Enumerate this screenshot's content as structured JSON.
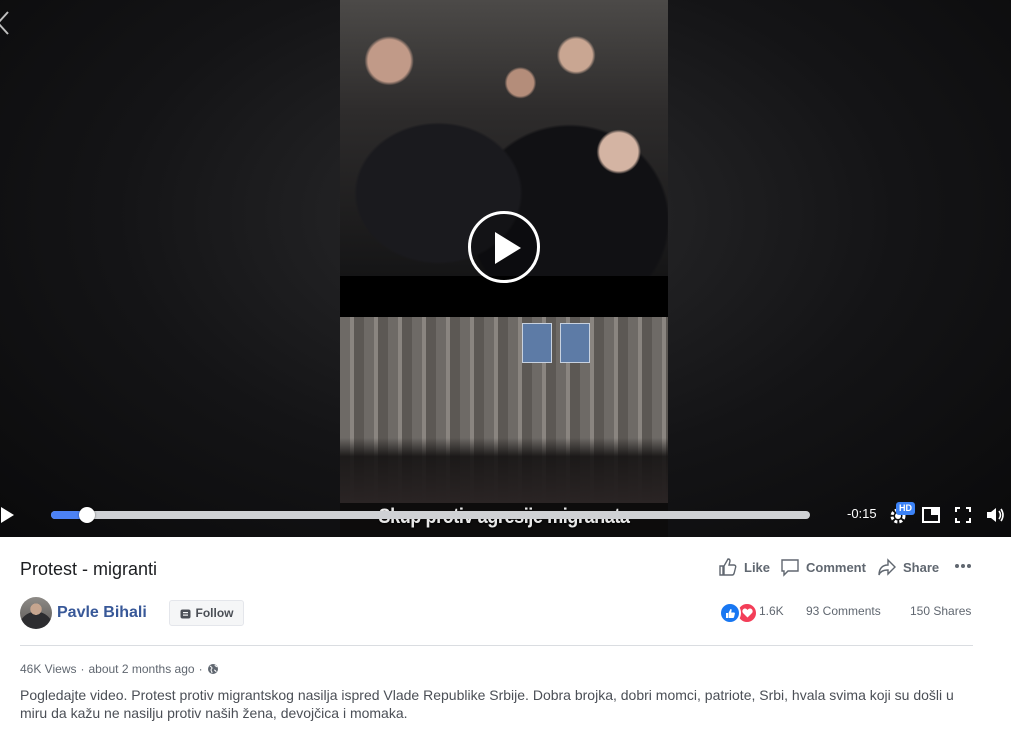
{
  "player": {
    "caption": "Skup protiv agresije migranata",
    "remaining_time": "-0:15",
    "hd_badge": "HD",
    "progress": 0.048
  },
  "post": {
    "title": "Protest - migranti",
    "author": "Pavle Bihali",
    "follow_label": "Follow",
    "actions": {
      "like": "Like",
      "comment": "Comment",
      "share": "Share"
    },
    "stats": {
      "reactions": "1.6K",
      "comments": "93 Comments",
      "shares": "150 Shares"
    },
    "meta": {
      "views": "46K Views",
      "separator": "·",
      "time": "about 2 months ago",
      "separator2": "·"
    },
    "description": "Pogledajte video. Protest protiv migrantskog nasilja ispred Vlade Republike Srbije. Dobra brojka, dobri momci, patriote, Srbi, hvala svima koji su došli u miru da kažu ne nasilju protiv naših žena, devojčica i momaka."
  },
  "colors": {
    "accent": "#4c82f5",
    "author_link": "#385898",
    "like_blue": "#1877f2",
    "love_red": "#f33e58"
  },
  "icons": [
    "back-icon",
    "play-icon",
    "settings-icon",
    "miniplayer-icon",
    "fullscreen-icon",
    "volume-icon",
    "like-icon",
    "comment-icon",
    "share-icon",
    "more-icon",
    "follow-icon",
    "globe-icon"
  ]
}
